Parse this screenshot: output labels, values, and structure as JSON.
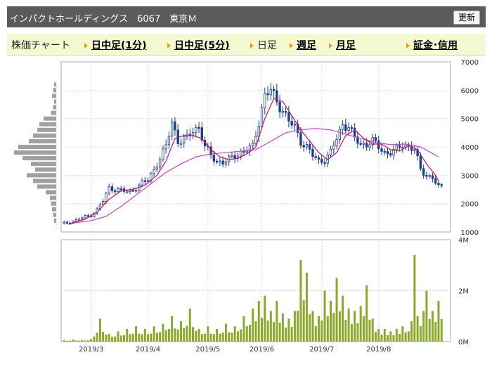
{
  "header": {
    "title": "インパクトホールディングス　6067　東京Ｍ",
    "refresh_label": "更新"
  },
  "tabs": [
    {
      "label": "株価チャート",
      "link": false
    },
    {
      "label": "日中足(1分)",
      "link": true
    },
    {
      "label": "日中足(5分)",
      "link": true
    },
    {
      "label": "日足",
      "link": false
    },
    {
      "label": "週足",
      "link": true
    },
    {
      "label": "月足",
      "link": true
    },
    {
      "label": "証金･信用",
      "link": true
    }
  ],
  "chart_data": {
    "type": "candlestick_with_volume",
    "price_axis": {
      "ylim": [
        1000,
        7000
      ],
      "ticks": [
        "1000",
        "2000",
        "3000",
        "4000",
        "5000",
        "6000",
        "7000"
      ]
    },
    "volume_axis": {
      "ylim": [
        0,
        4
      ],
      "ticks": [
        "0M",
        "2M",
        "4M"
      ]
    },
    "x_ticks": [
      "2019/3",
      "2019/4",
      "2019/5",
      "2019/6",
      "2019/7",
      "2019/8"
    ],
    "trading_days": 130,
    "x_tick_days": [
      10,
      29,
      49,
      67,
      87,
      106
    ],
    "colors": {
      "up": "#ffffff",
      "down": "#1a3e8c",
      "ma_short": "#cc1166",
      "ma_long": "#cc44cc",
      "volume": "#8aa82a",
      "profile": "#a0a0a0"
    },
    "price": [
      [
        1,
        1300
      ],
      [
        4,
        1380
      ],
      [
        7,
        1500
      ],
      [
        10,
        1600
      ],
      [
        12,
        1780
      ],
      [
        14,
        2100
      ],
      [
        16,
        2550
      ],
      [
        18,
        2500
      ],
      [
        21,
        2450
      ],
      [
        23,
        2420
      ],
      [
        26,
        2650
      ],
      [
        29,
        2850
      ],
      [
        31,
        3200
      ],
      [
        33,
        3600
      ],
      [
        35,
        4000
      ],
      [
        37,
        4900
      ],
      [
        39,
        4200
      ],
      [
        42,
        4300
      ],
      [
        44,
        4600
      ],
      [
        46,
        4700
      ],
      [
        48,
        4000
      ],
      [
        50,
        3700
      ],
      [
        52,
        3500
      ],
      [
        54,
        3450
      ],
      [
        56,
        3550
      ],
      [
        58,
        3700
      ],
      [
        60,
        3800
      ],
      [
        62,
        3900
      ],
      [
        64,
        4000
      ],
      [
        66,
        4900
      ],
      [
        68,
        5800
      ],
      [
        70,
        6000
      ],
      [
        72,
        5600
      ],
      [
        74,
        5300
      ],
      [
        76,
        4900
      ],
      [
        78,
        4700
      ],
      [
        80,
        4200
      ],
      [
        82,
        4000
      ],
      [
        84,
        3700
      ],
      [
        86,
        3500
      ],
      [
        88,
        3550
      ],
      [
        90,
        3800
      ],
      [
        92,
        4300
      ],
      [
        94,
        4800
      ],
      [
        96,
        4700
      ],
      [
        98,
        4300
      ],
      [
        100,
        4100
      ],
      [
        102,
        4100
      ],
      [
        104,
        4200
      ],
      [
        106,
        4000
      ],
      [
        108,
        3800
      ],
      [
        110,
        3800
      ],
      [
        112,
        3900
      ],
      [
        114,
        4100
      ],
      [
        116,
        4000
      ],
      [
        118,
        3900
      ],
      [
        120,
        3200
      ],
      [
        122,
        3000
      ],
      [
        124,
        2900
      ],
      [
        126,
        2600
      ]
    ],
    "ma_short": [
      [
        3,
        1300
      ],
      [
        8,
        1450
      ],
      [
        12,
        1700
      ],
      [
        16,
        2150
      ],
      [
        20,
        2450
      ],
      [
        24,
        2500
      ],
      [
        28,
        2650
      ],
      [
        32,
        3000
      ],
      [
        35,
        3500
      ],
      [
        38,
        4300
      ],
      [
        41,
        4400
      ],
      [
        44,
        4400
      ],
      [
        47,
        4300
      ],
      [
        50,
        3900
      ],
      [
        53,
        3650
      ],
      [
        56,
        3550
      ],
      [
        59,
        3600
      ],
      [
        62,
        3750
      ],
      [
        65,
        4000
      ],
      [
        68,
        5000
      ],
      [
        71,
        5700
      ],
      [
        74,
        5600
      ],
      [
        77,
        5100
      ],
      [
        80,
        4600
      ],
      [
        83,
        4200
      ],
      [
        86,
        3800
      ],
      [
        89,
        3550
      ],
      [
        92,
        3800
      ],
      [
        95,
        4400
      ],
      [
        98,
        4600
      ],
      [
        101,
        4300
      ],
      [
        104,
        4100
      ],
      [
        107,
        4100
      ],
      [
        110,
        3900
      ],
      [
        113,
        3850
      ],
      [
        116,
        4050
      ],
      [
        119,
        3900
      ],
      [
        122,
        3400
      ],
      [
        125,
        3000
      ],
      [
        126,
        2800
      ]
    ],
    "ma_long": [
      [
        3,
        1300
      ],
      [
        10,
        1400
      ],
      [
        15,
        1550
      ],
      [
        20,
        1900
      ],
      [
        25,
        2300
      ],
      [
        30,
        2700
      ],
      [
        35,
        3100
      ],
      [
        40,
        3400
      ],
      [
        45,
        3650
      ],
      [
        50,
        3750
      ],
      [
        55,
        3800
      ],
      [
        60,
        3850
      ],
      [
        65,
        3900
      ],
      [
        70,
        4200
      ],
      [
        75,
        4500
      ],
      [
        80,
        4600
      ],
      [
        85,
        4650
      ],
      [
        90,
        4600
      ],
      [
        95,
        4450
      ],
      [
        100,
        4300
      ],
      [
        105,
        4150
      ],
      [
        110,
        4080
      ],
      [
        115,
        4100
      ],
      [
        120,
        4000
      ],
      [
        126,
        3650
      ]
    ],
    "volume": [
      [
        1,
        0.05
      ],
      [
        4,
        0.08
      ],
      [
        7,
        0.06
      ],
      [
        10,
        0.1
      ],
      [
        13,
        0.9
      ],
      [
        16,
        0.3
      ],
      [
        19,
        0.4
      ],
      [
        22,
        0.5
      ],
      [
        25,
        0.6
      ],
      [
        28,
        0.5
      ],
      [
        31,
        0.6
      ],
      [
        34,
        0.7
      ],
      [
        37,
        1.0
      ],
      [
        40,
        0.8
      ],
      [
        43,
        1.3
      ],
      [
        46,
        0.5
      ],
      [
        49,
        0.6
      ],
      [
        52,
        0.5
      ],
      [
        55,
        0.7
      ],
      [
        58,
        0.6
      ],
      [
        61,
        1.0
      ],
      [
        64,
        1.3
      ],
      [
        66,
        1.6
      ],
      [
        68,
        1.8
      ],
      [
        70,
        1.2
      ],
      [
        72,
        1.6
      ],
      [
        74,
        1.1
      ],
      [
        76,
        0.9
      ],
      [
        78,
        1.2
      ],
      [
        80,
        3.2
      ],
      [
        82,
        2.7
      ],
      [
        84,
        1.2
      ],
      [
        86,
        1.0
      ],
      [
        88,
        2.0
      ],
      [
        90,
        1.6
      ],
      [
        92,
        2.5
      ],
      [
        94,
        1.8
      ],
      [
        96,
        1.3
      ],
      [
        98,
        1.2
      ],
      [
        100,
        1.4
      ],
      [
        102,
        2.2
      ],
      [
        104,
        0.9
      ],
      [
        106,
        0.5
      ],
      [
        108,
        0.5
      ],
      [
        110,
        0.4
      ],
      [
        112,
        0.5
      ],
      [
        114,
        0.6
      ],
      [
        117,
        0.8
      ],
      [
        118,
        3.4
      ],
      [
        119,
        1.0
      ],
      [
        121,
        1.2
      ],
      [
        122,
        2.0
      ],
      [
        124,
        1.2
      ],
      [
        126,
        1.6
      ]
    ],
    "volume_profile": [
      [
        6200,
        2
      ],
      [
        6000,
        3
      ],
      [
        5800,
        4
      ],
      [
        5600,
        2
      ],
      [
        5400,
        3
      ],
      [
        5200,
        5
      ],
      [
        5000,
        12
      ],
      [
        4800,
        16
      ],
      [
        4600,
        18
      ],
      [
        4400,
        22
      ],
      [
        4200,
        26
      ],
      [
        4000,
        36
      ],
      [
        3800,
        40
      ],
      [
        3600,
        32
      ],
      [
        3400,
        24
      ],
      [
        3200,
        20
      ],
      [
        3000,
        28
      ],
      [
        2800,
        22
      ],
      [
        2600,
        18
      ],
      [
        2400,
        10
      ],
      [
        2200,
        6
      ],
      [
        2000,
        5
      ],
      [
        1800,
        4
      ],
      [
        1600,
        3
      ],
      [
        1400,
        2
      ]
    ]
  }
}
